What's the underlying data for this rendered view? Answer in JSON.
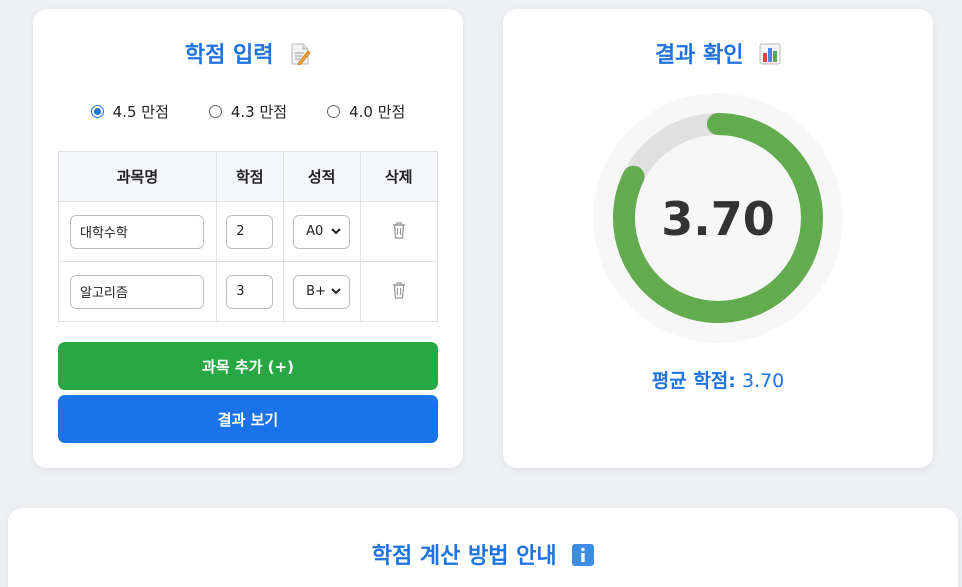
{
  "input_card": {
    "title": "학점 입력",
    "title_icon": "memo-icon",
    "scale_options": [
      {
        "label": "4.5 만점",
        "checked": true
      },
      {
        "label": "4.3 만점",
        "checked": false
      },
      {
        "label": "4.0 만점",
        "checked": false
      }
    ],
    "table": {
      "headers": [
        "과목명",
        "학점",
        "성적",
        "삭제"
      ],
      "rows": [
        {
          "name": "대학수학",
          "credit": "2",
          "grade": "A0"
        },
        {
          "name": "알고리즘",
          "credit": "3",
          "grade": "B+"
        }
      ]
    },
    "add_button_label": "과목 추가 (+)",
    "view_button_label": "결과 보기"
  },
  "result_card": {
    "title": "결과 확인",
    "title_icon": "bar-chart-icon",
    "gauge_value": "3.70",
    "gauge_fraction": 0.822,
    "average_label": "평균 학점:",
    "average_value": "3.70"
  },
  "guide_card": {
    "title": "학점 계산 방법 안내",
    "title_icon": "info-icon"
  },
  "colors": {
    "accent": "#1f73e0",
    "add_button": "#28a745",
    "view_button": "#1a73e8",
    "gauge_fill": "#62ab4e",
    "gauge_track": "#e0e0e0"
  }
}
